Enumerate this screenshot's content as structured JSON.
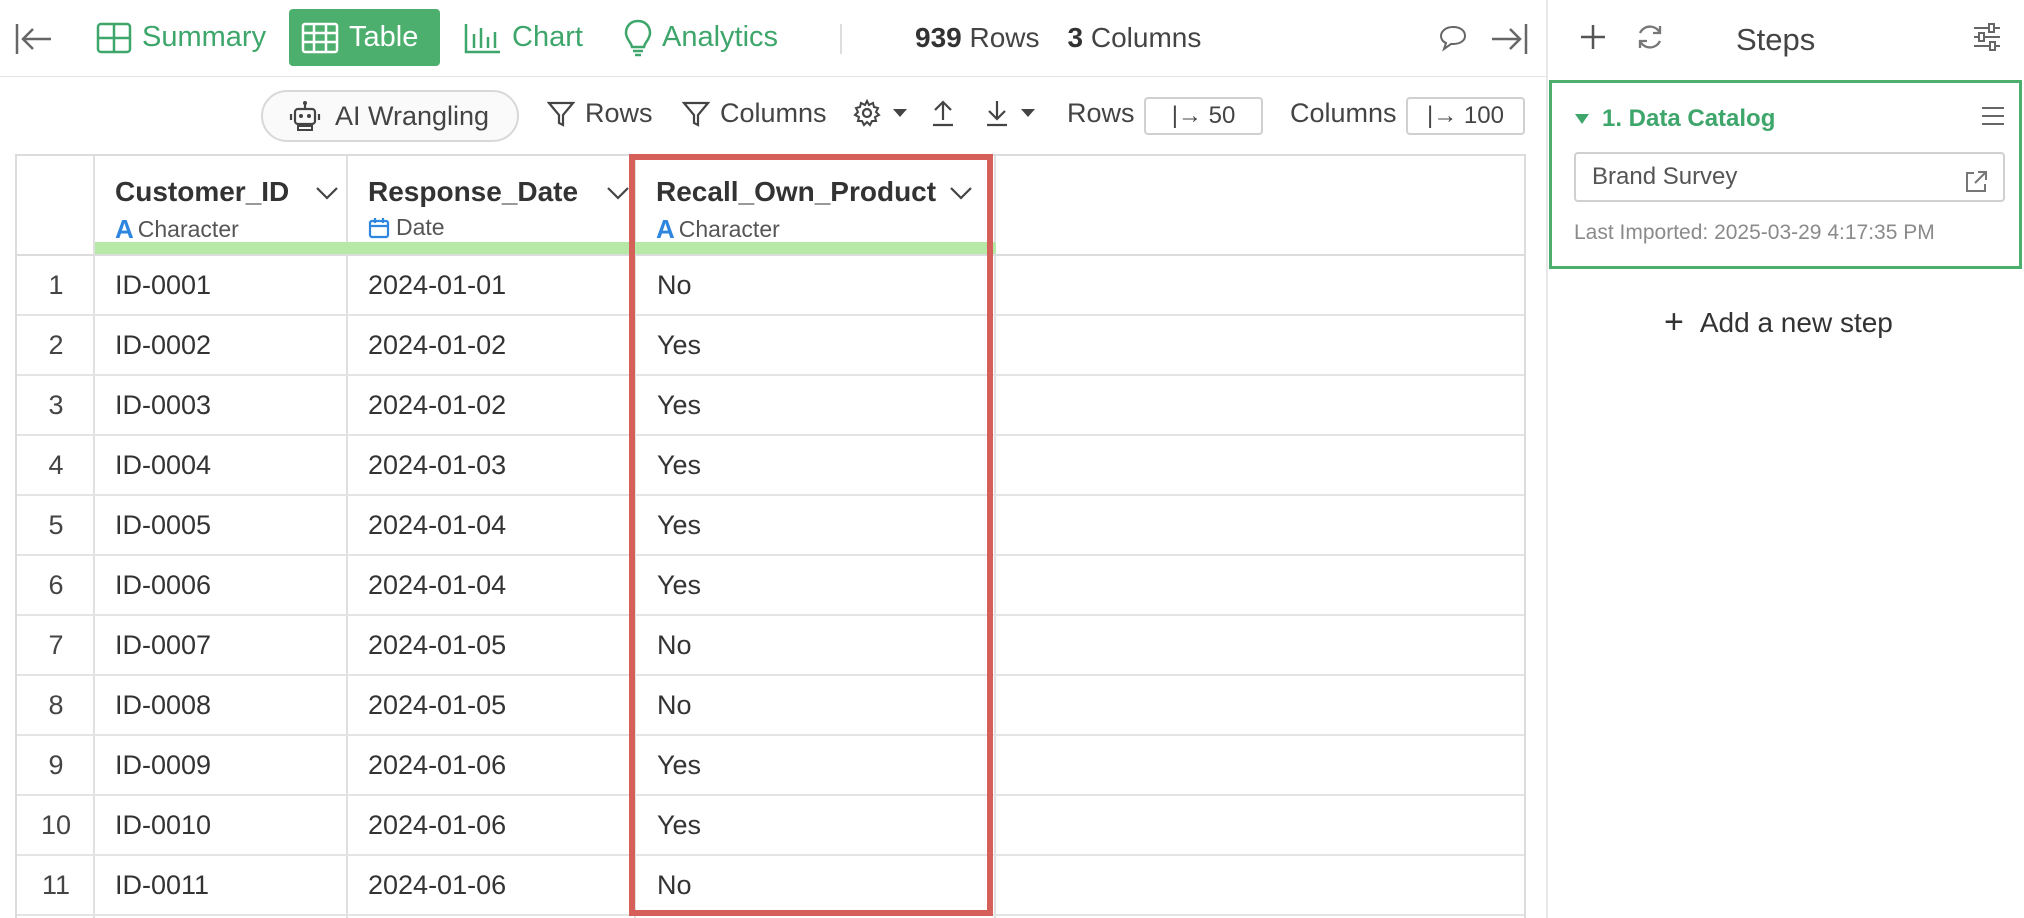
{
  "tabs": {
    "summary": "Summary",
    "table": "Table",
    "chart": "Chart",
    "analytics": "Analytics"
  },
  "counts": {
    "rows_num": "939",
    "rows_label": "Rows",
    "cols_num": "3",
    "cols_label": "Columns"
  },
  "toolbar": {
    "ai_wrangling": "AI Wrangling",
    "rows_filter": "Rows",
    "columns_filter": "Columns",
    "rows_label": "Rows",
    "rows_limit": "|→ 50",
    "columns_label": "Columns",
    "columns_limit": "|→ 100"
  },
  "columns": [
    {
      "name": "Customer_ID",
      "type": "Character",
      "type_icon": "A"
    },
    {
      "name": "Response_Date",
      "type": "Date",
      "type_icon": "calendar-icon"
    },
    {
      "name": "Recall_Own_Product",
      "type": "Character",
      "type_icon": "A"
    }
  ],
  "rows": [
    {
      "idx": "1",
      "a": "ID-0001",
      "b": "2024-01-01",
      "c": "No"
    },
    {
      "idx": "2",
      "a": "ID-0002",
      "b": "2024-01-02",
      "c": "Yes"
    },
    {
      "idx": "3",
      "a": "ID-0003",
      "b": "2024-01-02",
      "c": "Yes"
    },
    {
      "idx": "4",
      "a": "ID-0004",
      "b": "2024-01-03",
      "c": "Yes"
    },
    {
      "idx": "5",
      "a": "ID-0005",
      "b": "2024-01-04",
      "c": "Yes"
    },
    {
      "idx": "6",
      "a": "ID-0006",
      "b": "2024-01-04",
      "c": "Yes"
    },
    {
      "idx": "7",
      "a": "ID-0007",
      "b": "2024-01-05",
      "c": "No"
    },
    {
      "idx": "8",
      "a": "ID-0008",
      "b": "2024-01-05",
      "c": "No"
    },
    {
      "idx": "9",
      "a": "ID-0009",
      "b": "2024-01-06",
      "c": "Yes"
    },
    {
      "idx": "10",
      "a": "ID-0010",
      "b": "2024-01-06",
      "c": "Yes"
    },
    {
      "idx": "11",
      "a": "ID-0011",
      "b": "2024-01-06",
      "c": "No"
    }
  ],
  "steps": {
    "title": "Steps",
    "step1_title": "1. Data Catalog",
    "catalog_name": "Brand Survey",
    "last_imported": "Last Imported: 2025-03-29 4:17:35 PM",
    "add_step": "Add a new step"
  },
  "colors": {
    "accent": "#4caf6e",
    "highlight": "#d65f59",
    "type_character": "#2e86de",
    "column_bar": "#b6e8a8"
  }
}
